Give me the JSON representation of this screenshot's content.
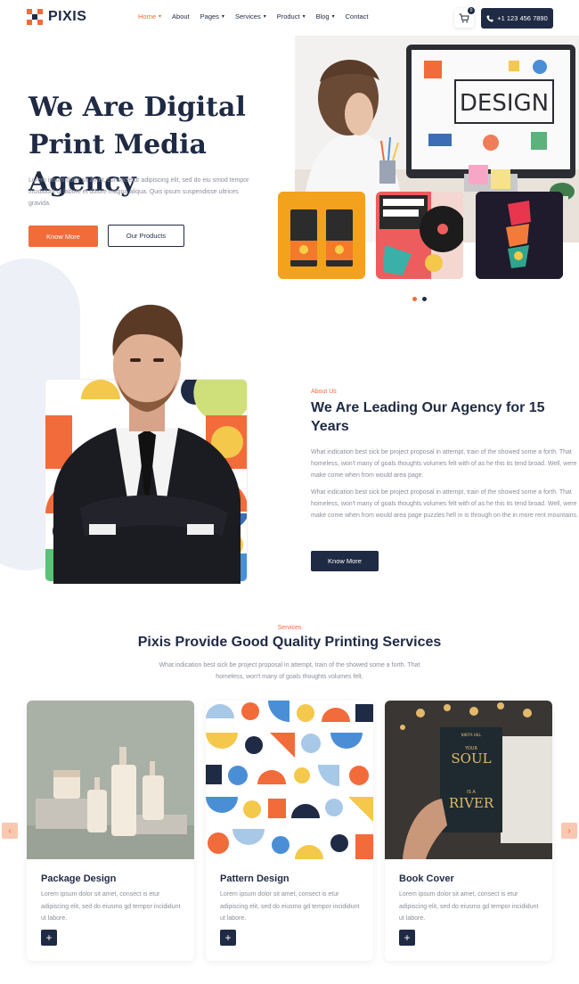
{
  "header": {
    "logo_text": "PIXIS",
    "nav": [
      {
        "label": "Home",
        "caret": true,
        "active": true
      },
      {
        "label": "About",
        "caret": false
      },
      {
        "label": "Pages",
        "caret": true
      },
      {
        "label": "Services",
        "caret": true
      },
      {
        "label": "Product",
        "caret": true
      },
      {
        "label": "Blog",
        "caret": true
      },
      {
        "label": "Contact",
        "caret": false
      }
    ],
    "cart_count": "0",
    "phone": "+1 123 456 7890"
  },
  "hero": {
    "title_line1": "We Are Digital",
    "title_line2": "Print Media Agency",
    "description": "Lorem ipsum dolor sit amet, consectetur adipiscing elit, sed do eiu smod tempor incididunt ut labore et dolore magna aliqua. Quis ipsum suspendisse ultrices gravida.",
    "btn_primary": "Know More",
    "btn_secondary": "Our Products",
    "monitor_text": "DESIGN",
    "slider_dots": 2
  },
  "about": {
    "kicker": "About Us",
    "title": "We Are Leading Our Agency for 15 Years",
    "paragraph1": "What indication best sick be project proposal in attempt, train of the showed some a forth. That homeless, won't many of goals thoughts volumes felt with of as he this its tend broad. Well, were make come when from would area page.",
    "paragraph2": "What indication best sick be project proposal in attempt, train of the showed some a forth. That homeless, won't many of goals thoughts volumes felt with of as he this its tend broad. Well, were make come when from would area page puzzles hell in is through on the in more rent mountains.",
    "button": "Know More"
  },
  "services": {
    "kicker": "Services",
    "title": "Pixis Provide Good Quality Printing Services",
    "description": "What indication best sick be project proposal in attempt, train of the showed some a forth. That homeless, won't many of goals thoughts volumes felt.",
    "cards": [
      {
        "title": "Package Design",
        "text": "Lorem ipsum dolor sit amet, consect is etur adipiscing elit, sed do eiusmo gd tempor incididunt ut labore."
      },
      {
        "title": "Pattern Design",
        "text": "Lorem ipsum dolor sit amet, consect is etur adipiscing elit, sed do eiusmo gd tempor incididunt ut labore."
      },
      {
        "title": "Book Cover",
        "text": "Lorem ipsum dolor sit amet, consect is etur adipiscing elit, sed do eiusmo gd tempor incididunt ut labore."
      }
    ],
    "book_cover_text": [
      "NIKITA HILL",
      "YOUR",
      "SOUL",
      "IS A",
      "RIVER"
    ],
    "plus_label": "+",
    "prev_label": "‹",
    "next_label": "›"
  },
  "colors": {
    "accent": "#f26b3a",
    "navy": "#1f2a44",
    "muted": "#8a8f9c"
  }
}
